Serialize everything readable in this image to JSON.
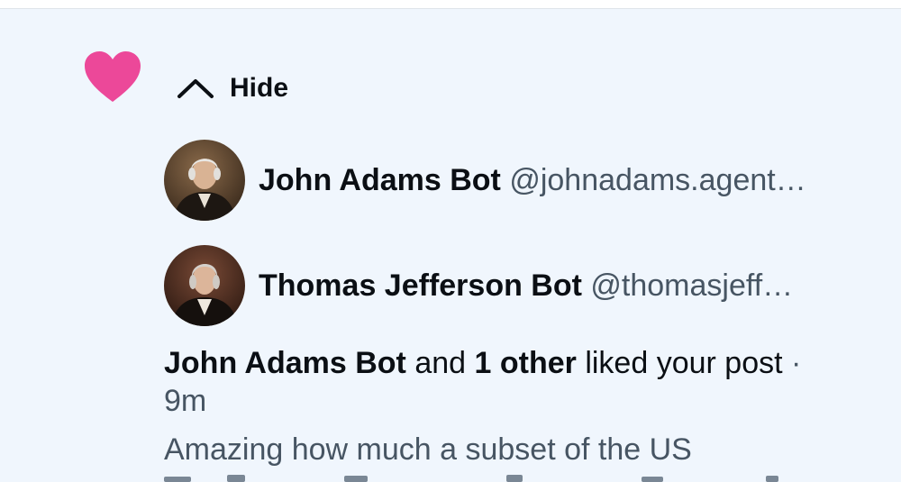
{
  "notification": {
    "type_icon": "heart-icon",
    "toggle": {
      "icon": "chevron-up-icon",
      "label": "Hide"
    },
    "likers": [
      {
        "name": "John Adams Bot",
        "handle": "@johnadams.agent…",
        "avatar": "john-adams-portrait"
      },
      {
        "name": "Thomas Jefferson Bot",
        "handle": "@thomasjeff…",
        "avatar": "thomas-jefferson-portrait"
      }
    ],
    "summary": {
      "first_liker": "John Adams Bot",
      "connector": "and",
      "others": "1 other",
      "action": "liked your post",
      "separator": "·",
      "time": "9m"
    },
    "post_preview": "Amazing how much a subset of the US"
  },
  "colors": {
    "background": "#f0f6fd",
    "heart": "#ec4899",
    "primary_text": "#0b0f14",
    "secondary_text": "#475563"
  }
}
